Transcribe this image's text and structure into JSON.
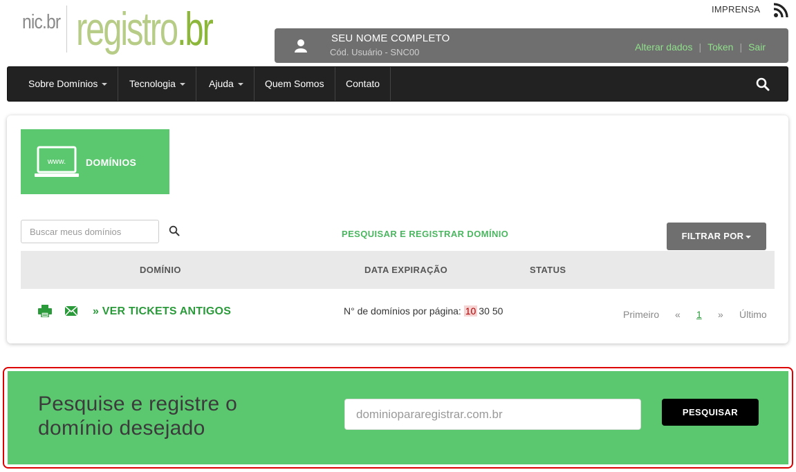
{
  "header": {
    "logo_nic": "nic.br",
    "logo_registro": "registro",
    "logo_br": ".br",
    "imprensa": "IMPRENSA",
    "rss_icon": "rss-icon"
  },
  "user": {
    "name": "SEU NOME COMPLETO",
    "code": "Cód. Usuário - SNC00",
    "links": [
      "Alterar dados",
      "Token",
      "Sair"
    ],
    "separator": "|"
  },
  "nav": {
    "items": [
      {
        "label": "Sobre Domínios",
        "dropdown": true
      },
      {
        "label": "Tecnologia",
        "dropdown": true
      },
      {
        "label": "Ajuda",
        "dropdown": true
      },
      {
        "label": "Quem Somos",
        "dropdown": false
      },
      {
        "label": "Contato",
        "dropdown": false
      }
    ],
    "search_icon": "search-icon"
  },
  "panel": {
    "tile_title": "DOMÍNIOS",
    "tile_icon_text": "www.",
    "search_placeholder": "Buscar meus domínios",
    "register_link": "PESQUISAR E REGISTRAR DOMÍNIO",
    "filter_label": "FILTRAR POR",
    "table_headers": [
      "DOMÍNIO",
      "DATA EXPIRAÇÃO",
      "STATUS"
    ],
    "old_tickets": "» VER TICKETS ANTIGOS",
    "per_page_label": "N° de domínios por página:",
    "per_page_options": [
      "10",
      "30",
      "50"
    ],
    "per_page_selected": "10",
    "pagination": {
      "first": "Primeiro",
      "prev": "«",
      "current": "1",
      "next": "»",
      "last": "Último"
    }
  },
  "banner": {
    "title": "Pesquise e registre o domínio desejado",
    "input_placeholder": "dominiopararegistrar.com.br",
    "button_label": "PESQUISAR"
  },
  "colors": {
    "green": "#5bc870",
    "link_green": "#2a9a3a",
    "userbar": "#6f6f6f",
    "navbar": "#222222",
    "highlight_outline": "#dd0000"
  }
}
